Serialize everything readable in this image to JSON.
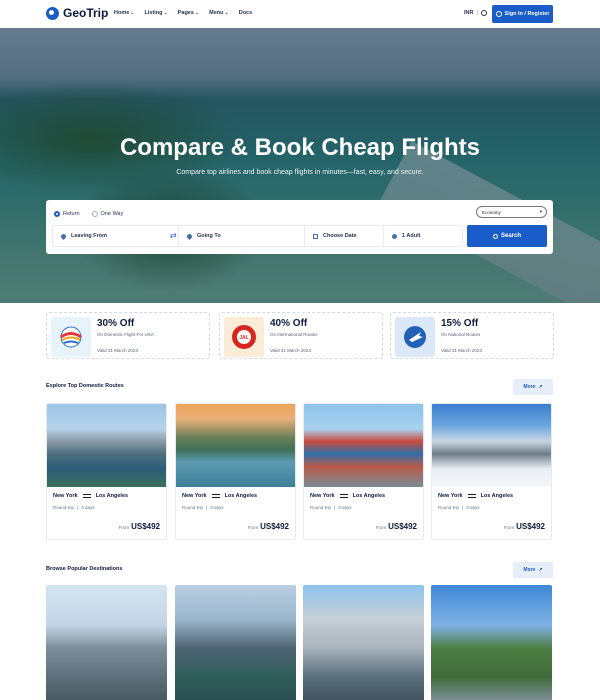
{
  "nav": {
    "logo": "GeoTrip",
    "menu": [
      {
        "label": "Home"
      },
      {
        "label": "Listing"
      },
      {
        "label": "Pages"
      },
      {
        "label": "Menu"
      },
      {
        "label": "Docs"
      }
    ],
    "currency": "INR",
    "signin": "Sign In / Register"
  },
  "hero": {
    "title": "Compare & Book Cheap Flights",
    "subtitle": "Compare top airlines and book cheap flights in minutes—fast, easy, and secure."
  },
  "search": {
    "trip_return": "Return",
    "trip_oneway": "One Way",
    "cabin": "Economy",
    "from_placeholder": "Leaving From",
    "to_placeholder": "Going To",
    "date_placeholder": "Choose Date",
    "travellers": "1 Adult",
    "button": "Search"
  },
  "offers": [
    {
      "title": "30% Off",
      "desc": "On Domestic Flight For USA",
      "valid": "Valid 31 March 2023",
      "logo": "plane-globe-logo"
    },
    {
      "title": "40% Off",
      "desc": "On International Routes",
      "valid": "Valid 31 March 2023",
      "logo": "jal-logo"
    },
    {
      "title": "15% Off",
      "desc": "On National Routes",
      "valid": "Valid 31 March 2023",
      "logo": "airline-logo"
    }
  ],
  "routes": {
    "title": "Explore Top Domestic Routes",
    "more": "More",
    "items": [
      {
        "from": "New York",
        "to": "Los Angeles",
        "trip": "Round-trip",
        "duration": "3 days",
        "price_prefix": "From",
        "price": "US$492"
      },
      {
        "from": "New York",
        "to": "Los Angeles",
        "trip": "Round-trip",
        "duration": "3 days",
        "price_prefix": "From",
        "price": "US$492"
      },
      {
        "from": "New York",
        "to": "Los Angeles",
        "trip": "Round-trip",
        "duration": "3 days",
        "price_prefix": "From",
        "price": "US$492"
      },
      {
        "from": "New York",
        "to": "Los Angeles",
        "trip": "Round-trip",
        "duration": "3 days",
        "price_prefix": "From",
        "price": "US$492"
      }
    ]
  },
  "destinations": {
    "title": "Browse Popular Destinations",
    "more": "More"
  },
  "colors": {
    "primary": "#1a5cc8",
    "heading": "#0d1b3e"
  }
}
